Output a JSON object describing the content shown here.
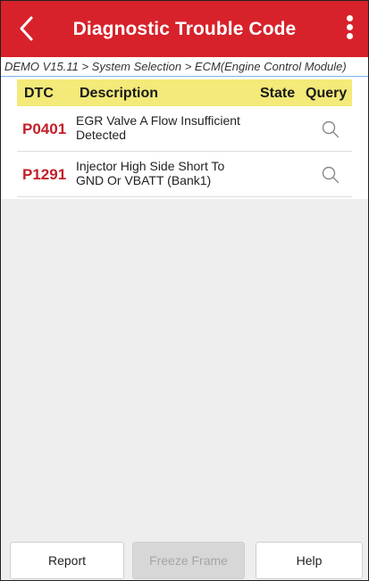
{
  "header": {
    "title": "Diagnostic Trouble Code",
    "back_icon": "chevron-left-icon",
    "menu_icon": "more-vertical-icon",
    "bg_color": "#d7222b"
  },
  "breadcrumb": {
    "text": "DEMO V15.11 > System Selection > ECM(Engine Control Module)"
  },
  "table": {
    "headers": {
      "dtc": "DTC",
      "description": "Description",
      "state": "State",
      "query": "Query"
    },
    "rows": [
      {
        "code": "P0401",
        "description_line1": "EGR Valve A Flow Insufficient",
        "description_line2": "Detected",
        "state": "",
        "query_icon": "search-icon"
      },
      {
        "code": "P1291",
        "description_line1": "Injector High Side Short To",
        "description_line2": "GND Or VBATT (Bank1)",
        "state": "",
        "query_icon": "search-icon"
      }
    ]
  },
  "footer": {
    "report_label": "Report",
    "freeze_frame_label": "Freeze Frame",
    "help_label": "Help"
  }
}
